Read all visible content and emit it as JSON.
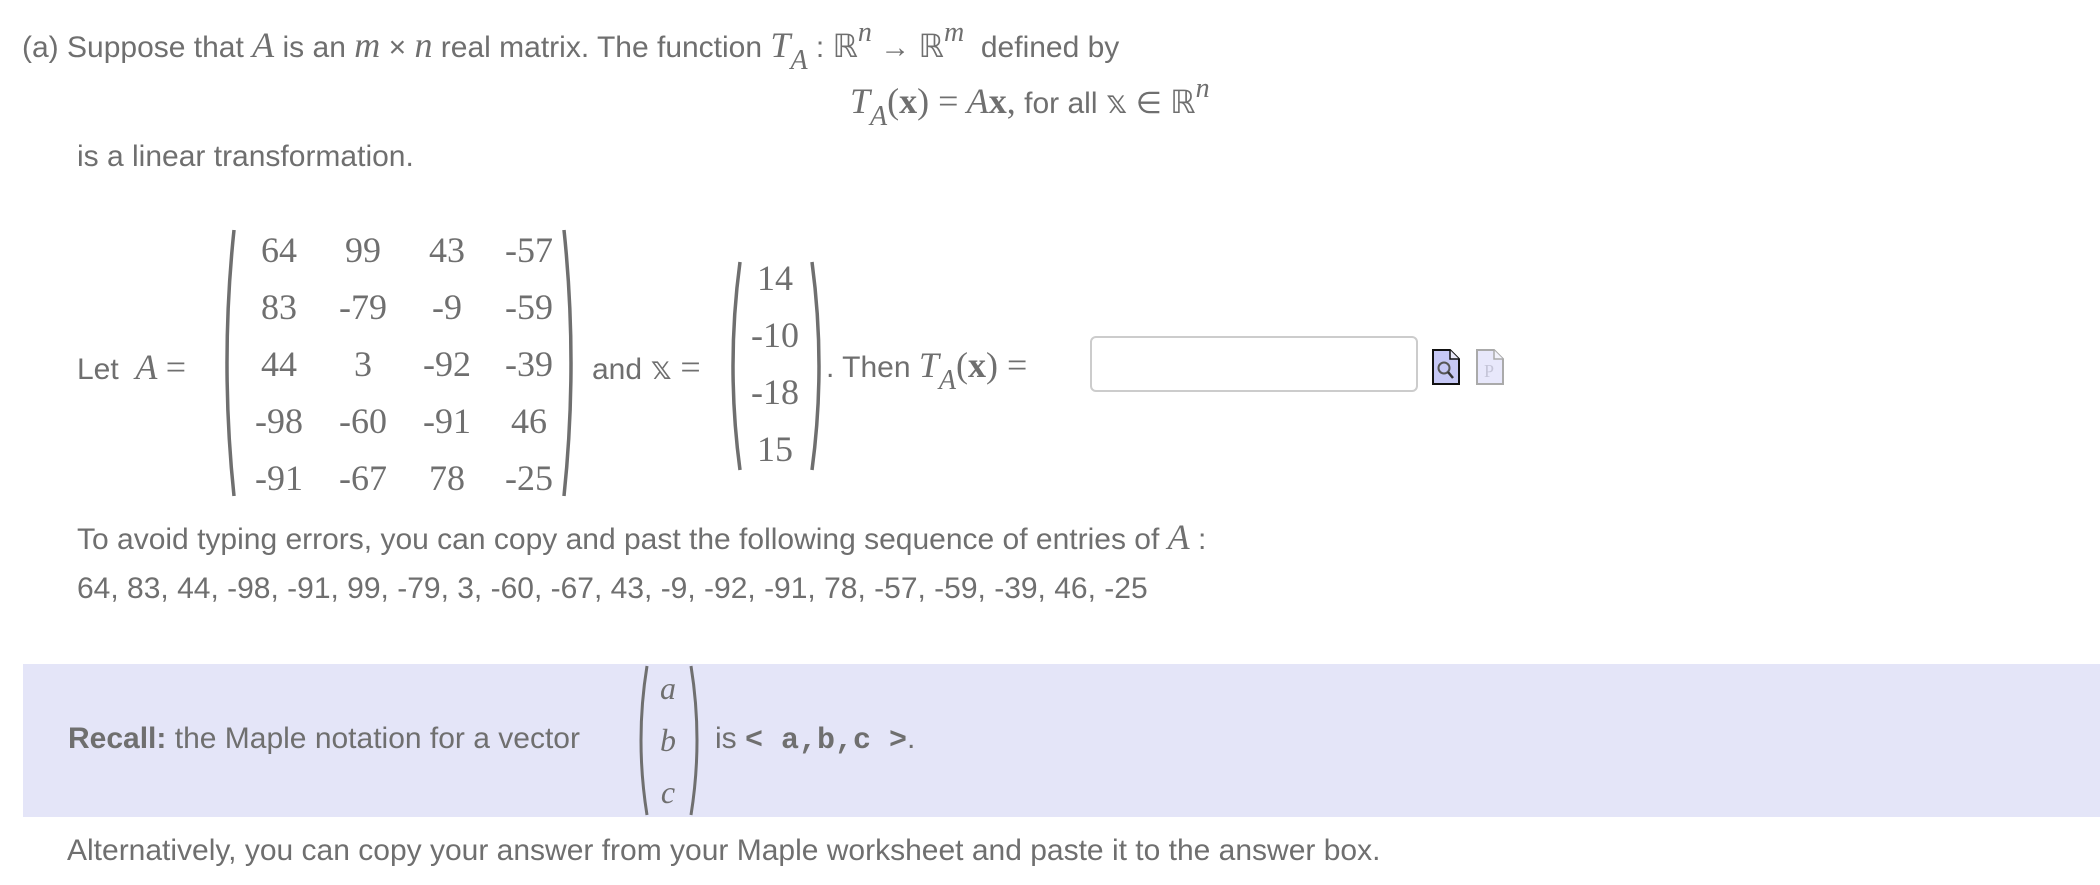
{
  "question": {
    "intro": {
      "part_label": "(a)",
      "text_1": "Suppose that",
      "sym_A": "A",
      "text_2": "is an",
      "sym_m": "m",
      "times": "×",
      "sym_n": "n",
      "text_3": "real matrix. The function",
      "sym_T": "T",
      "sub_A": "A",
      "colon": ":",
      "R": "ℝ",
      "sup_n": "n",
      "arrow": "→",
      "sup_m": "m",
      "text_4": "defined by"
    },
    "definition": {
      "T": "T",
      "sub_A": "A",
      "lhs_open": "(",
      "x_bold": "x",
      "lhs_close": ") =",
      "A": "A",
      "x_bold2": "x",
      "comma": ",",
      "text": "for all",
      "x_bb": "𝕩",
      "in": "∈",
      "R": "ℝ",
      "sup_n": "n"
    },
    "conclusion": "is a linear transformation.",
    "let_label": "Let",
    "A_sym": "A",
    "equals": "=",
    "matrix_A": [
      [
        "64",
        "99",
        "43",
        "-57"
      ],
      [
        "83",
        "-79",
        "-9",
        "-59"
      ],
      [
        "44",
        "3",
        "-92",
        "-39"
      ],
      [
        "-98",
        "-60",
        "-91",
        "46"
      ],
      [
        "-91",
        "-67",
        "78",
        "-25"
      ]
    ],
    "and_label": "and",
    "x_sym": "𝕩",
    "vector_x": [
      "14",
      "-10",
      "-18",
      "15"
    ],
    "then_label": ". Then",
    "then_T": "T",
    "then_sub": "A",
    "then_arg": "(",
    "then_x": "x",
    "then_close": ") =",
    "answer": {
      "value": "",
      "placeholder": ""
    },
    "copy_hint_1": "To avoid typing errors, you can copy and past the following sequence of entries of",
    "copy_hint_A": "A",
    "copy_hint_colon": ":",
    "sequence": "64, 83, 44, -98, -91, 99, -79, 3, -60, -67, 43, -9, -92, -91, 78, -57, -59, -39, 46, -25"
  },
  "icons": {
    "preview": "preview-icon",
    "maple_syntax": "maple-syntax-icon"
  },
  "recall": {
    "bold": "Recall:",
    "text": "the Maple notation for a vector",
    "vector": [
      "a",
      "b",
      "c"
    ],
    "is": "is",
    "notation": "< a,b,c >",
    "period": "."
  },
  "footer": "Alternatively, you can copy your answer from your Maple worksheet and paste it to the answer box.",
  "colors": {
    "text": "#6f6f6f",
    "recall_bg": "#e4e5f8",
    "input_border": "#cccccc",
    "preview_icon_fill": "#c6c8f5"
  }
}
